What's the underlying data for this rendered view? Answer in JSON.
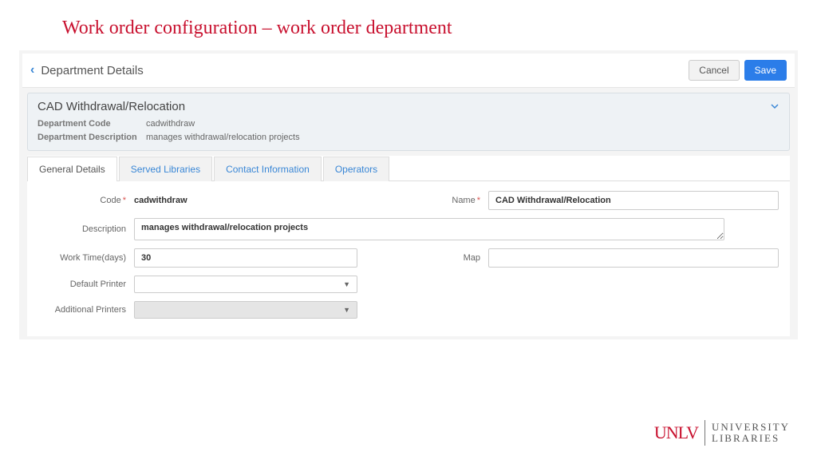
{
  "slide": {
    "title": "Work order configuration – work order department"
  },
  "header": {
    "title": "Department Details",
    "cancel": "Cancel",
    "save": "Save"
  },
  "summary": {
    "title": "CAD Withdrawal/Relocation",
    "codeLabel": "Department Code",
    "code": "cadwithdraw",
    "descLabel": "Department Description",
    "desc": "manages withdrawal/relocation projects"
  },
  "tabs": {
    "general": "General Details",
    "served": "Served Libraries",
    "contact": "Contact Information",
    "operators": "Operators"
  },
  "form": {
    "codeLabel": "Code",
    "codeValue": "cadwithdraw",
    "nameLabel": "Name",
    "nameValue": "CAD Withdrawal/Relocation",
    "descLabel": "Description",
    "descValue": "manages withdrawal/relocation projects",
    "workTimeLabel": "Work Time(days)",
    "workTimeValue": "30",
    "mapLabel": "Map",
    "mapValue": "",
    "defaultPrinterLabel": "Default Printer",
    "addPrintersLabel": "Additional Printers"
  },
  "footer": {
    "logo": "UNLV",
    "libraries1": "UNIVERSITY",
    "libraries2": "LIBRARIES"
  }
}
